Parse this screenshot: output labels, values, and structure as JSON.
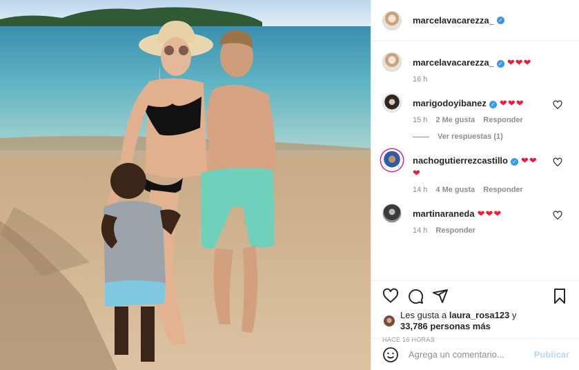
{
  "post": {
    "author": "marcelavacarezza_",
    "verified_mark": "✓",
    "photo_alt": "Beach photo"
  },
  "caption": {
    "username": "marcelavacarezza_",
    "text": "❤❤❤",
    "time": "16 h"
  },
  "comments": [
    {
      "username": "marigodoyibanez",
      "verified": true,
      "text": "❤❤❤",
      "time": "15 h",
      "likes": "2 Me gusta",
      "reply": "Responder",
      "view_replies": "Ver respuestas (1)"
    },
    {
      "username": "nachogutierrezcastillo",
      "verified": true,
      "text": "❤❤",
      "text2": "❤",
      "time": "14 h",
      "likes": "4 Me gusta",
      "reply": "Responder"
    },
    {
      "username": "martinaraneda",
      "verified": false,
      "text": "❤❤❤",
      "time": "14 h",
      "reply": "Responder"
    }
  ],
  "actions": {
    "like_icon": "heart-outline-icon",
    "comment_icon": "comment-bubble-icon",
    "share_icon": "paper-plane-icon",
    "save_icon": "bookmark-icon"
  },
  "likes_summary": {
    "prefix": "Les gusta a ",
    "user": "laura_rosa123",
    "middle": " y",
    "count": "33,786 personas más"
  },
  "posted": "HACE 16 HORAS",
  "composer": {
    "placeholder": "Agrega un comentario...",
    "post_label": "Publicar"
  },
  "colors": {
    "verified": "#3897f0",
    "heart": "#ed1c3a",
    "post_disabled": "#b3dbff",
    "muted": "#8e8e8e"
  }
}
